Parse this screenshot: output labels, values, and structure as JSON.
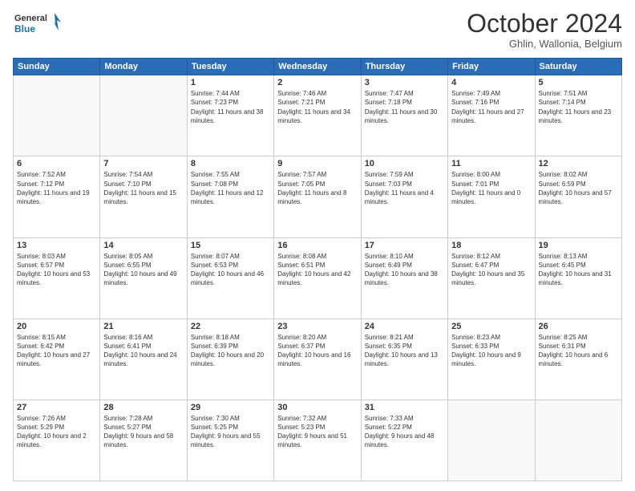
{
  "header": {
    "logo_line1": "General",
    "logo_line2": "Blue",
    "month": "October 2024",
    "location": "Ghlin, Wallonia, Belgium"
  },
  "columns": [
    "Sunday",
    "Monday",
    "Tuesday",
    "Wednesday",
    "Thursday",
    "Friday",
    "Saturday"
  ],
  "weeks": [
    [
      {
        "day": "",
        "info": ""
      },
      {
        "day": "",
        "info": ""
      },
      {
        "day": "1",
        "info": "Sunrise: 7:44 AM\nSunset: 7:23 PM\nDaylight: 11 hours and 38 minutes."
      },
      {
        "day": "2",
        "info": "Sunrise: 7:46 AM\nSunset: 7:21 PM\nDaylight: 11 hours and 34 minutes."
      },
      {
        "day": "3",
        "info": "Sunrise: 7:47 AM\nSunset: 7:18 PM\nDaylight: 11 hours and 30 minutes."
      },
      {
        "day": "4",
        "info": "Sunrise: 7:49 AM\nSunset: 7:16 PM\nDaylight: 11 hours and 27 minutes."
      },
      {
        "day": "5",
        "info": "Sunrise: 7:51 AM\nSunset: 7:14 PM\nDaylight: 11 hours and 23 minutes."
      }
    ],
    [
      {
        "day": "6",
        "info": "Sunrise: 7:52 AM\nSunset: 7:12 PM\nDaylight: 11 hours and 19 minutes."
      },
      {
        "day": "7",
        "info": "Sunrise: 7:54 AM\nSunset: 7:10 PM\nDaylight: 11 hours and 15 minutes."
      },
      {
        "day": "8",
        "info": "Sunrise: 7:55 AM\nSunset: 7:08 PM\nDaylight: 11 hours and 12 minutes."
      },
      {
        "day": "9",
        "info": "Sunrise: 7:57 AM\nSunset: 7:05 PM\nDaylight: 11 hours and 8 minutes."
      },
      {
        "day": "10",
        "info": "Sunrise: 7:59 AM\nSunset: 7:03 PM\nDaylight: 11 hours and 4 minutes."
      },
      {
        "day": "11",
        "info": "Sunrise: 8:00 AM\nSunset: 7:01 PM\nDaylight: 11 hours and 0 minutes."
      },
      {
        "day": "12",
        "info": "Sunrise: 8:02 AM\nSunset: 6:59 PM\nDaylight: 10 hours and 57 minutes."
      }
    ],
    [
      {
        "day": "13",
        "info": "Sunrise: 8:03 AM\nSunset: 6:57 PM\nDaylight: 10 hours and 53 minutes."
      },
      {
        "day": "14",
        "info": "Sunrise: 8:05 AM\nSunset: 6:55 PM\nDaylight: 10 hours and 49 minutes."
      },
      {
        "day": "15",
        "info": "Sunrise: 8:07 AM\nSunset: 6:53 PM\nDaylight: 10 hours and 46 minutes."
      },
      {
        "day": "16",
        "info": "Sunrise: 8:08 AM\nSunset: 6:51 PM\nDaylight: 10 hours and 42 minutes."
      },
      {
        "day": "17",
        "info": "Sunrise: 8:10 AM\nSunset: 6:49 PM\nDaylight: 10 hours and 38 minutes."
      },
      {
        "day": "18",
        "info": "Sunrise: 8:12 AM\nSunset: 6:47 PM\nDaylight: 10 hours and 35 minutes."
      },
      {
        "day": "19",
        "info": "Sunrise: 8:13 AM\nSunset: 6:45 PM\nDaylight: 10 hours and 31 minutes."
      }
    ],
    [
      {
        "day": "20",
        "info": "Sunrise: 8:15 AM\nSunset: 6:42 PM\nDaylight: 10 hours and 27 minutes."
      },
      {
        "day": "21",
        "info": "Sunrise: 8:16 AM\nSunset: 6:41 PM\nDaylight: 10 hours and 24 minutes."
      },
      {
        "day": "22",
        "info": "Sunrise: 8:18 AM\nSunset: 6:39 PM\nDaylight: 10 hours and 20 minutes."
      },
      {
        "day": "23",
        "info": "Sunrise: 8:20 AM\nSunset: 6:37 PM\nDaylight: 10 hours and 16 minutes."
      },
      {
        "day": "24",
        "info": "Sunrise: 8:21 AM\nSunset: 6:35 PM\nDaylight: 10 hours and 13 minutes."
      },
      {
        "day": "25",
        "info": "Sunrise: 8:23 AM\nSunset: 6:33 PM\nDaylight: 10 hours and 9 minutes."
      },
      {
        "day": "26",
        "info": "Sunrise: 8:25 AM\nSunset: 6:31 PM\nDaylight: 10 hours and 6 minutes."
      }
    ],
    [
      {
        "day": "27",
        "info": "Sunrise: 7:26 AM\nSunset: 5:29 PM\nDaylight: 10 hours and 2 minutes."
      },
      {
        "day": "28",
        "info": "Sunrise: 7:28 AM\nSunset: 5:27 PM\nDaylight: 9 hours and 58 minutes."
      },
      {
        "day": "29",
        "info": "Sunrise: 7:30 AM\nSunset: 5:25 PM\nDaylight: 9 hours and 55 minutes."
      },
      {
        "day": "30",
        "info": "Sunrise: 7:32 AM\nSunset: 5:23 PM\nDaylight: 9 hours and 51 minutes."
      },
      {
        "day": "31",
        "info": "Sunrise: 7:33 AM\nSunset: 5:22 PM\nDaylight: 9 hours and 48 minutes."
      },
      {
        "day": "",
        "info": ""
      },
      {
        "day": "",
        "info": ""
      }
    ]
  ]
}
